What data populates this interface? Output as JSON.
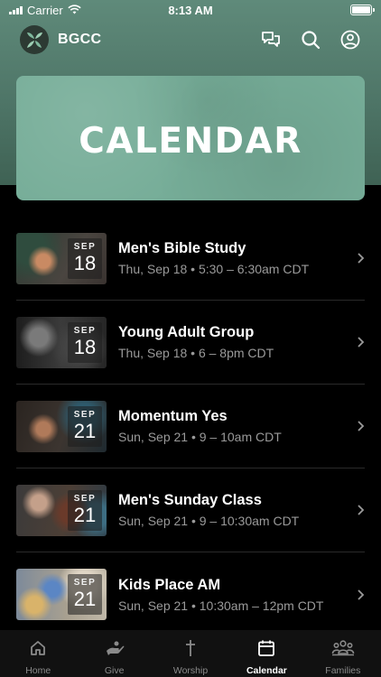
{
  "status_bar": {
    "carrier": "Carrier",
    "time": "8:13 AM"
  },
  "header": {
    "brand": "BGCC",
    "icons": [
      "chat-icon",
      "search-icon",
      "profile-icon"
    ]
  },
  "hero": {
    "title": "CALENDAR"
  },
  "events": [
    {
      "month": "SEP",
      "day": "18",
      "title": "Men's Bible Study",
      "meta": "Thu, Sep 18 • 5:30 – 6:30am CDT"
    },
    {
      "month": "SEP",
      "day": "18",
      "title": "Young Adult Group",
      "meta": "Thu, Sep 18 • 6 – 8pm CDT"
    },
    {
      "month": "SEP",
      "day": "21",
      "title": "Momentum Yes",
      "meta": "Sun, Sep 21 • 9 – 10am CDT"
    },
    {
      "month": "SEP",
      "day": "21",
      "title": "Men's Sunday Class",
      "meta": "Sun, Sep 21 • 9 – 10:30am CDT"
    },
    {
      "month": "SEP",
      "day": "21",
      "title": "Kids Place AM",
      "meta": "Sun, Sep 21 • 10:30am – 12pm CDT"
    }
  ],
  "tabs": [
    {
      "label": "Home",
      "icon": "home-icon",
      "active": false
    },
    {
      "label": "Give",
      "icon": "give-icon",
      "active": false
    },
    {
      "label": "Worship",
      "icon": "cross-icon",
      "active": false
    },
    {
      "label": "Calendar",
      "icon": "calendar-icon",
      "active": true
    },
    {
      "label": "Families",
      "icon": "families-icon",
      "active": false
    }
  ],
  "colors": {
    "accent": "#76ad98",
    "header_bg": "#5f8a7a",
    "background": "#000000",
    "muted_text": "#9a9a9a"
  }
}
